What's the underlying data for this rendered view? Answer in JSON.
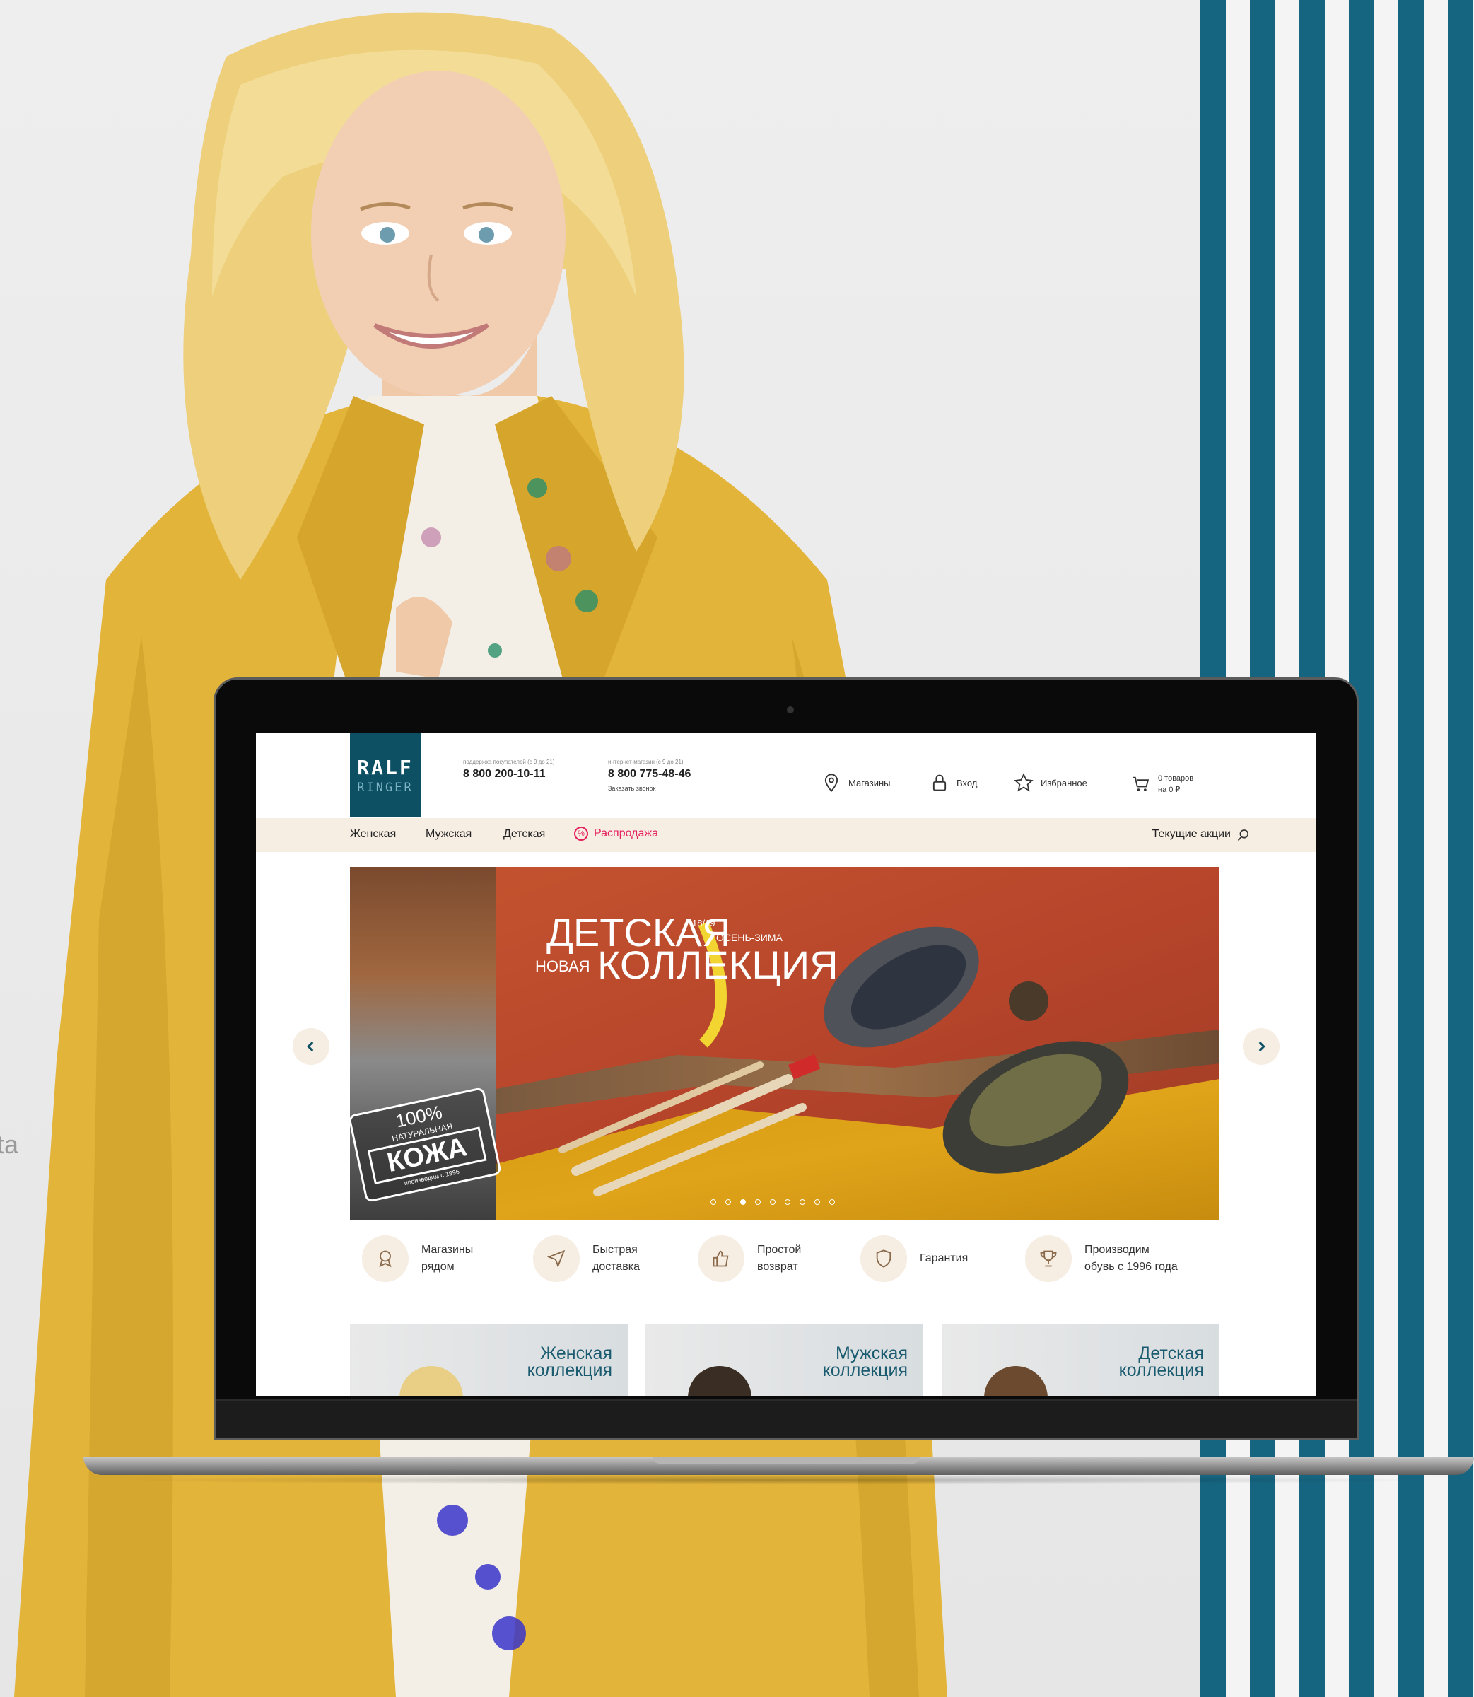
{
  "backdrop": {
    "side_text": "ta",
    "stripe_color": "#166580",
    "accent_coat": "#e6b83a"
  },
  "site": {
    "logo": {
      "line1": "RALF",
      "line2": "RINGER"
    },
    "phones": [
      {
        "caption": "поддержка покупателей (с 9 до 21)",
        "number": "8 800 200-10-11",
        "extra": ""
      },
      {
        "caption": "интернет-магазин (с 9 до 21)",
        "number": "8 800 775-48-46",
        "extra": "Заказать звонок"
      }
    ],
    "header_icons": {
      "stores": "Магазины",
      "login": "Вход",
      "favorites": "Избранное",
      "cart_line1": "0 товаров",
      "cart_line2": "на 0 ₽"
    },
    "nav": {
      "women": "Женская",
      "men": "Мужская",
      "kids": "Детская",
      "sale": "Распродажа",
      "sale_icon": "%",
      "promo": "Текущие акции"
    },
    "banner": {
      "title1": "ДЕТСКАЯ",
      "title2": "КОЛЛЕКЦИЯ",
      "new_label": "НОВАЯ",
      "season": "18/19",
      "season2": "ОСЕНЬ-ЗИМА",
      "badge_pct": "100%",
      "badge_natural": "НАТУРАЛЬНАЯ",
      "badge_leather": "КОЖА",
      "badge_note": "производим с 1996",
      "dot_count": 9,
      "active_dot": 3
    },
    "features": [
      {
        "label": "Магазины\nрядом",
        "icon": "location-icon"
      },
      {
        "label": "Быстрая\nдоставка",
        "icon": "send-icon"
      },
      {
        "label": "Простой\nвозврат",
        "icon": "thumb-up-icon"
      },
      {
        "label": "Гарантия",
        "icon": "shield-icon"
      },
      {
        "label": "Производим\nобувь с 1996 года",
        "icon": "trophy-icon"
      }
    ],
    "collections": [
      {
        "label": "Женская\nколлекция"
      },
      {
        "label": "Мужская\nколлекция"
      },
      {
        "label": "Детская\nколлекция"
      }
    ]
  }
}
